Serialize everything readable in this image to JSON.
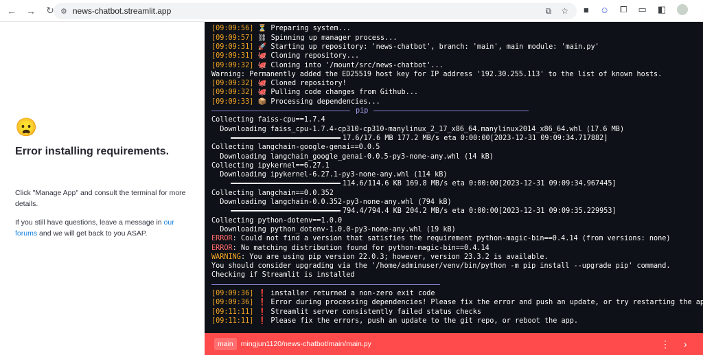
{
  "browser": {
    "url": "news-chatbot.streamlit.app"
  },
  "page": {
    "emoji": "😦",
    "title": "Error installing requirements.",
    "p1": "Click \"Manage App\" and consult the terminal for more details.",
    "p2_before": "If you still have questions, leave a message in ",
    "p2_link": "our forums",
    "p2_after": " and we will get back to you ASAP."
  },
  "terminal": {
    "lines": [
      {
        "t": "ts",
        "ts": "[09:09:56]",
        "icon": "⏳",
        "text": "Preparing system..."
      },
      {
        "t": "ts",
        "ts": "[09:09:57]",
        "icon": "⛓",
        "text": "Spinning up manager process..."
      },
      {
        "t": "ts",
        "ts": "[09:09:31]",
        "icon": "🚀",
        "text": "Starting up repository: 'news-chatbot', branch: 'main', main module: 'main.py'"
      },
      {
        "t": "ts",
        "ts": "[09:09:31]",
        "icon": "🐙",
        "text": "Cloning repository..."
      },
      {
        "t": "ts",
        "ts": "[09:09:32]",
        "icon": "🐙",
        "text": "Cloning into '/mount/src/news-chatbot'..."
      },
      {
        "t": "plain",
        "text": "Warning: Permanently added the ED25519 host key for IP address '192.30.255.113' to the list of known hosts."
      },
      {
        "t": "ts",
        "ts": "[09:09:32]",
        "icon": "🐙",
        "text": "Cloned repository!"
      },
      {
        "t": "ts",
        "ts": "[09:09:32]",
        "icon": "🐙",
        "text": "Pulling code changes from Github..."
      },
      {
        "t": "ts",
        "ts": "[09:09:33]",
        "icon": "📦",
        "text": "Processing dependencies..."
      },
      {
        "t": "divider",
        "label": "pip"
      },
      {
        "t": "plain",
        "text": "Collecting faiss-cpu==1.7.4"
      },
      {
        "t": "plain",
        "text": "  Downloading faiss_cpu-1.7.4-cp310-cp310-manylinux_2_17_x86_64.manylinux2014_x86_64.whl (17.6 MB)"
      },
      {
        "t": "progress",
        "text": "17.6/17.6 MB 177.2 MB/s eta 0:00:00[2023-12-31 09:09:34.717882]",
        "fraction": 1.0
      },
      {
        "t": "plain",
        "text": "Collecting langchain-google-genai==0.0.5"
      },
      {
        "t": "plain",
        "text": "  Downloading langchain_google_genai-0.0.5-py3-none-any.whl (14 kB)"
      },
      {
        "t": "plain",
        "text": "Collecting ipykernel==6.27.1"
      },
      {
        "t": "plain",
        "text": "  Downloading ipykernel-6.27.1-py3-none-any.whl (114 kB)"
      },
      {
        "t": "progress",
        "text": "114.6/114.6 KB 169.8 MB/s eta 0:00:00[2023-12-31 09:09:34.967445]",
        "fraction": 1.0
      },
      {
        "t": "plain",
        "text": "Collecting langchain==0.0.352"
      },
      {
        "t": "plain",
        "text": "  Downloading langchain-0.0.352-py3-none-any.whl (794 kB)"
      },
      {
        "t": "progress",
        "text": "794.4/794.4 KB 204.2 MB/s eta 0:00:00[2023-12-31 09:09:35.229953]",
        "fraction": 1.0
      },
      {
        "t": "plain",
        "text": "Collecting python-dotenv==1.0.0"
      },
      {
        "t": "plain",
        "text": "  Downloading python_dotenv-1.0.0-py3-none-any.whl (19 kB)"
      },
      {
        "t": "error",
        "label": "ERROR",
        "text": ": Could not find a version that satisfies the requirement python-magic-bin==0.4.14 (from versions: none)"
      },
      {
        "t": "error",
        "label": "ERROR",
        "text": ": No matching distribution found for python-magic-bin==0.4.14"
      },
      {
        "t": "warn",
        "label": "WARNING",
        "text": ": You are using pip version 22.0.3; however, version 23.3.2 is available."
      },
      {
        "t": "plain",
        "text": "You should consider upgrading via the '/home/adminuser/venv/bin/python -m pip install --upgrade pip' command."
      },
      {
        "t": "plain",
        "text": "Checking if Streamlit is installed"
      },
      {
        "t": "divider",
        "label": ""
      },
      {
        "t": "ts",
        "ts": "[09:09:36]",
        "icon": "❗",
        "text": "installer returned a non-zero exit code"
      },
      {
        "t": "ts",
        "ts": "[09:09:36]",
        "icon": "❗",
        "text": "Error during processing dependencies! Please fix the error and push an update, or try restarting the app."
      },
      {
        "t": "ts",
        "ts": "[09:11:11]",
        "icon": "❗",
        "text": "Streamlit server consistently failed status checks"
      },
      {
        "t": "ts",
        "ts": "[09:11:11]",
        "icon": "❗",
        "text": "Please fix the errors, push an update to the git repo, or reboot the app."
      }
    ]
  },
  "footer": {
    "branch": "main",
    "path": "mingjun1120/news-chatbot/main/main.py"
  },
  "colors": {
    "terminal_bg": "#0e1117",
    "footer": "#ff4b4b",
    "timestamp": "#f5a623",
    "divider": "#8a7fd4"
  }
}
